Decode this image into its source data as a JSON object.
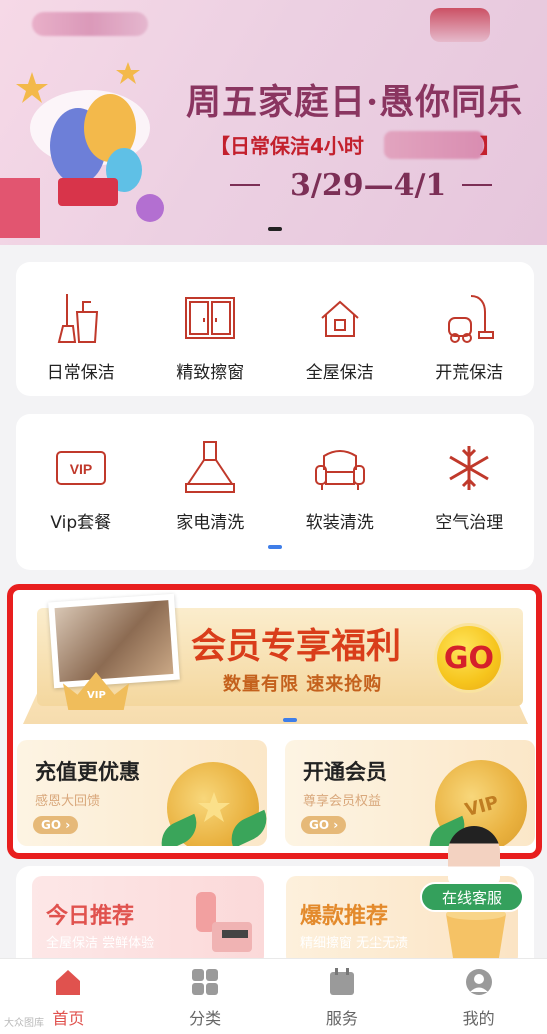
{
  "banner": {
    "title": "周五家庭日·愚你同乐",
    "subtitle": "【日常保洁4小时",
    "subtitle_end": "】",
    "dates": "3/29—4/1"
  },
  "service_categories": [
    {
      "label": "日常保洁",
      "icon": "broom-bucket-icon"
    },
    {
      "label": "精致擦窗",
      "icon": "window-icon"
    },
    {
      "label": "全屋保洁",
      "icon": "house-icon"
    },
    {
      "label": "开荒保洁",
      "icon": "vacuum-icon"
    }
  ],
  "service_categories_2": [
    {
      "label": "Vip套餐",
      "icon": "vip-card-icon"
    },
    {
      "label": "家电清洗",
      "icon": "range-hood-icon"
    },
    {
      "label": "软装清洗",
      "icon": "sofa-icon"
    },
    {
      "label": "空气治理",
      "icon": "snowflake-icon"
    }
  ],
  "member_promo": {
    "title": "会员专享福利",
    "subtitle": "数量有限 速来抢购",
    "go": "GO",
    "crown_text": "VIP"
  },
  "benefit_cards": [
    {
      "title": "充值更优惠",
      "subtitle": "感恩大回馈",
      "go": "GO ›"
    },
    {
      "title": "开通会员",
      "subtitle": "尊享会员权益",
      "go": "GO ›",
      "coin_text": "VIP"
    }
  ],
  "recommendations": [
    {
      "title": "今日推荐",
      "subtitle": "全屋保洁 尝鲜体验",
      "color": "#e0524e"
    },
    {
      "title": "爆款推荐",
      "subtitle": "精细擦窗 无尘无渍",
      "color": "#e38a2c"
    }
  ],
  "customer_service": {
    "label": "在线客服"
  },
  "tabbar": [
    {
      "label": "首页",
      "icon": "home-icon",
      "active": true
    },
    {
      "label": "分类",
      "icon": "grid-icon",
      "active": false
    },
    {
      "label": "服务",
      "icon": "calendar-icon",
      "active": false
    },
    {
      "label": "我的",
      "icon": "user-icon",
      "active": false
    }
  ],
  "watermark": "大众图库",
  "colors": {
    "accent": "#e0524e",
    "icon_red": "#c0392b",
    "highlight_border": "#e81e1e",
    "green": "#34a05c"
  }
}
